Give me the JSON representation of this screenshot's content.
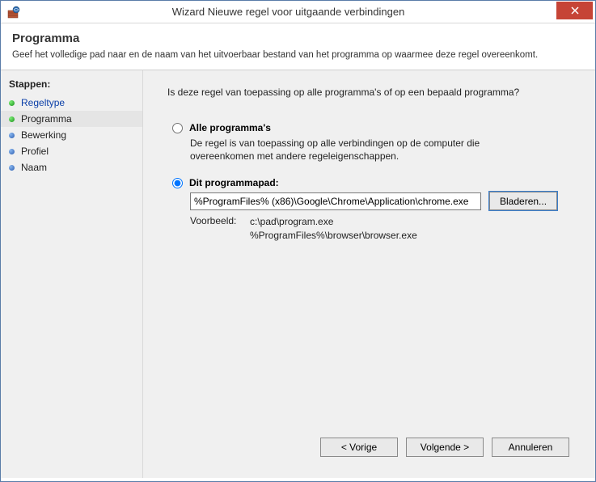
{
  "titlebar": {
    "title": "Wizard Nieuwe regel voor uitgaande verbindingen"
  },
  "header": {
    "title": "Programma",
    "description": "Geef het volledige pad naar en de naam van het uitvoerbaar bestand van het programma op waarmee deze regel overeenkomt."
  },
  "sidebar": {
    "heading": "Stappen:",
    "items": [
      {
        "label": "Regeltype",
        "bullet": "green",
        "link": true,
        "active": false
      },
      {
        "label": "Programma",
        "bullet": "green",
        "link": false,
        "active": true
      },
      {
        "label": "Bewerking",
        "bullet": "blue",
        "link": false,
        "active": false
      },
      {
        "label": "Profiel",
        "bullet": "blue",
        "link": false,
        "active": false
      },
      {
        "label": "Naam",
        "bullet": "blue",
        "link": false,
        "active": false
      }
    ]
  },
  "main": {
    "question": "Is deze regel van toepassing op alle programma's of op een bepaald programma?",
    "option_all": {
      "label": "Alle programma's",
      "description": "De regel is van toepassing op alle verbindingen op de computer die overeenkomen met andere regeleigenschappen.",
      "checked": false
    },
    "option_path": {
      "label": "Dit programmapad:",
      "checked": true,
      "value": "%ProgramFiles% (x86)\\Google\\Chrome\\Application\\chrome.exe",
      "browse": "Bladeren..."
    },
    "example": {
      "label": "Voorbeeld:",
      "line1": "c:\\pad\\program.exe",
      "line2": "%ProgramFiles%\\browser\\browser.exe"
    }
  },
  "footer": {
    "back": "< Vorige",
    "next": "Volgende >",
    "cancel": "Annuleren"
  }
}
